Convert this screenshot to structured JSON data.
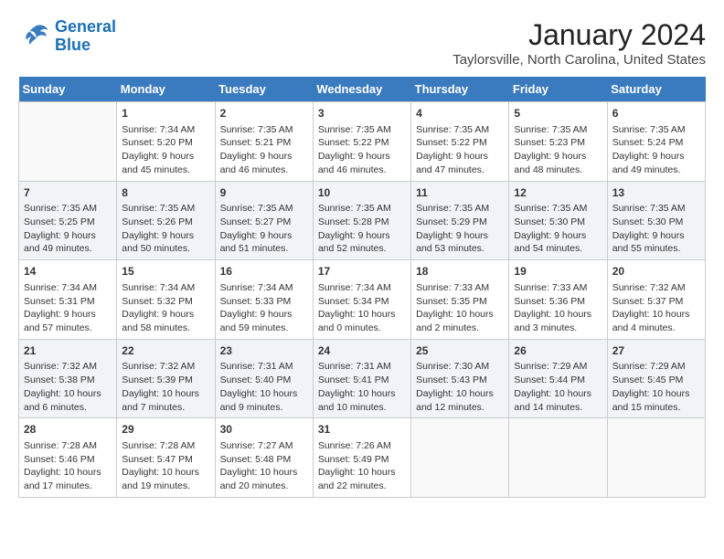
{
  "header": {
    "logo_line1": "General",
    "logo_line2": "Blue",
    "month": "January 2024",
    "location": "Taylorsville, North Carolina, United States"
  },
  "weekdays": [
    "Sunday",
    "Monday",
    "Tuesday",
    "Wednesday",
    "Thursday",
    "Friday",
    "Saturday"
  ],
  "weeks": [
    [
      {
        "day": "",
        "info": ""
      },
      {
        "day": "1",
        "info": "Sunrise: 7:34 AM\nSunset: 5:20 PM\nDaylight: 9 hours\nand 45 minutes."
      },
      {
        "day": "2",
        "info": "Sunrise: 7:35 AM\nSunset: 5:21 PM\nDaylight: 9 hours\nand 46 minutes."
      },
      {
        "day": "3",
        "info": "Sunrise: 7:35 AM\nSunset: 5:22 PM\nDaylight: 9 hours\nand 46 minutes."
      },
      {
        "day": "4",
        "info": "Sunrise: 7:35 AM\nSunset: 5:22 PM\nDaylight: 9 hours\nand 47 minutes."
      },
      {
        "day": "5",
        "info": "Sunrise: 7:35 AM\nSunset: 5:23 PM\nDaylight: 9 hours\nand 48 minutes."
      },
      {
        "day": "6",
        "info": "Sunrise: 7:35 AM\nSunset: 5:24 PM\nDaylight: 9 hours\nand 49 minutes."
      }
    ],
    [
      {
        "day": "7",
        "info": "Sunrise: 7:35 AM\nSunset: 5:25 PM\nDaylight: 9 hours\nand 49 minutes."
      },
      {
        "day": "8",
        "info": "Sunrise: 7:35 AM\nSunset: 5:26 PM\nDaylight: 9 hours\nand 50 minutes."
      },
      {
        "day": "9",
        "info": "Sunrise: 7:35 AM\nSunset: 5:27 PM\nDaylight: 9 hours\nand 51 minutes."
      },
      {
        "day": "10",
        "info": "Sunrise: 7:35 AM\nSunset: 5:28 PM\nDaylight: 9 hours\nand 52 minutes."
      },
      {
        "day": "11",
        "info": "Sunrise: 7:35 AM\nSunset: 5:29 PM\nDaylight: 9 hours\nand 53 minutes."
      },
      {
        "day": "12",
        "info": "Sunrise: 7:35 AM\nSunset: 5:30 PM\nDaylight: 9 hours\nand 54 minutes."
      },
      {
        "day": "13",
        "info": "Sunrise: 7:35 AM\nSunset: 5:30 PM\nDaylight: 9 hours\nand 55 minutes."
      }
    ],
    [
      {
        "day": "14",
        "info": "Sunrise: 7:34 AM\nSunset: 5:31 PM\nDaylight: 9 hours\nand 57 minutes."
      },
      {
        "day": "15",
        "info": "Sunrise: 7:34 AM\nSunset: 5:32 PM\nDaylight: 9 hours\nand 58 minutes."
      },
      {
        "day": "16",
        "info": "Sunrise: 7:34 AM\nSunset: 5:33 PM\nDaylight: 9 hours\nand 59 minutes."
      },
      {
        "day": "17",
        "info": "Sunrise: 7:34 AM\nSunset: 5:34 PM\nDaylight: 10 hours\nand 0 minutes."
      },
      {
        "day": "18",
        "info": "Sunrise: 7:33 AM\nSunset: 5:35 PM\nDaylight: 10 hours\nand 2 minutes."
      },
      {
        "day": "19",
        "info": "Sunrise: 7:33 AM\nSunset: 5:36 PM\nDaylight: 10 hours\nand 3 minutes."
      },
      {
        "day": "20",
        "info": "Sunrise: 7:32 AM\nSunset: 5:37 PM\nDaylight: 10 hours\nand 4 minutes."
      }
    ],
    [
      {
        "day": "21",
        "info": "Sunrise: 7:32 AM\nSunset: 5:38 PM\nDaylight: 10 hours\nand 6 minutes."
      },
      {
        "day": "22",
        "info": "Sunrise: 7:32 AM\nSunset: 5:39 PM\nDaylight: 10 hours\nand 7 minutes."
      },
      {
        "day": "23",
        "info": "Sunrise: 7:31 AM\nSunset: 5:40 PM\nDaylight: 10 hours\nand 9 minutes."
      },
      {
        "day": "24",
        "info": "Sunrise: 7:31 AM\nSunset: 5:41 PM\nDaylight: 10 hours\nand 10 minutes."
      },
      {
        "day": "25",
        "info": "Sunrise: 7:30 AM\nSunset: 5:43 PM\nDaylight: 10 hours\nand 12 minutes."
      },
      {
        "day": "26",
        "info": "Sunrise: 7:29 AM\nSunset: 5:44 PM\nDaylight: 10 hours\nand 14 minutes."
      },
      {
        "day": "27",
        "info": "Sunrise: 7:29 AM\nSunset: 5:45 PM\nDaylight: 10 hours\nand 15 minutes."
      }
    ],
    [
      {
        "day": "28",
        "info": "Sunrise: 7:28 AM\nSunset: 5:46 PM\nDaylight: 10 hours\nand 17 minutes."
      },
      {
        "day": "29",
        "info": "Sunrise: 7:28 AM\nSunset: 5:47 PM\nDaylight: 10 hours\nand 19 minutes."
      },
      {
        "day": "30",
        "info": "Sunrise: 7:27 AM\nSunset: 5:48 PM\nDaylight: 10 hours\nand 20 minutes."
      },
      {
        "day": "31",
        "info": "Sunrise: 7:26 AM\nSunset: 5:49 PM\nDaylight: 10 hours\nand 22 minutes."
      },
      {
        "day": "",
        "info": ""
      },
      {
        "day": "",
        "info": ""
      },
      {
        "day": "",
        "info": ""
      }
    ]
  ]
}
